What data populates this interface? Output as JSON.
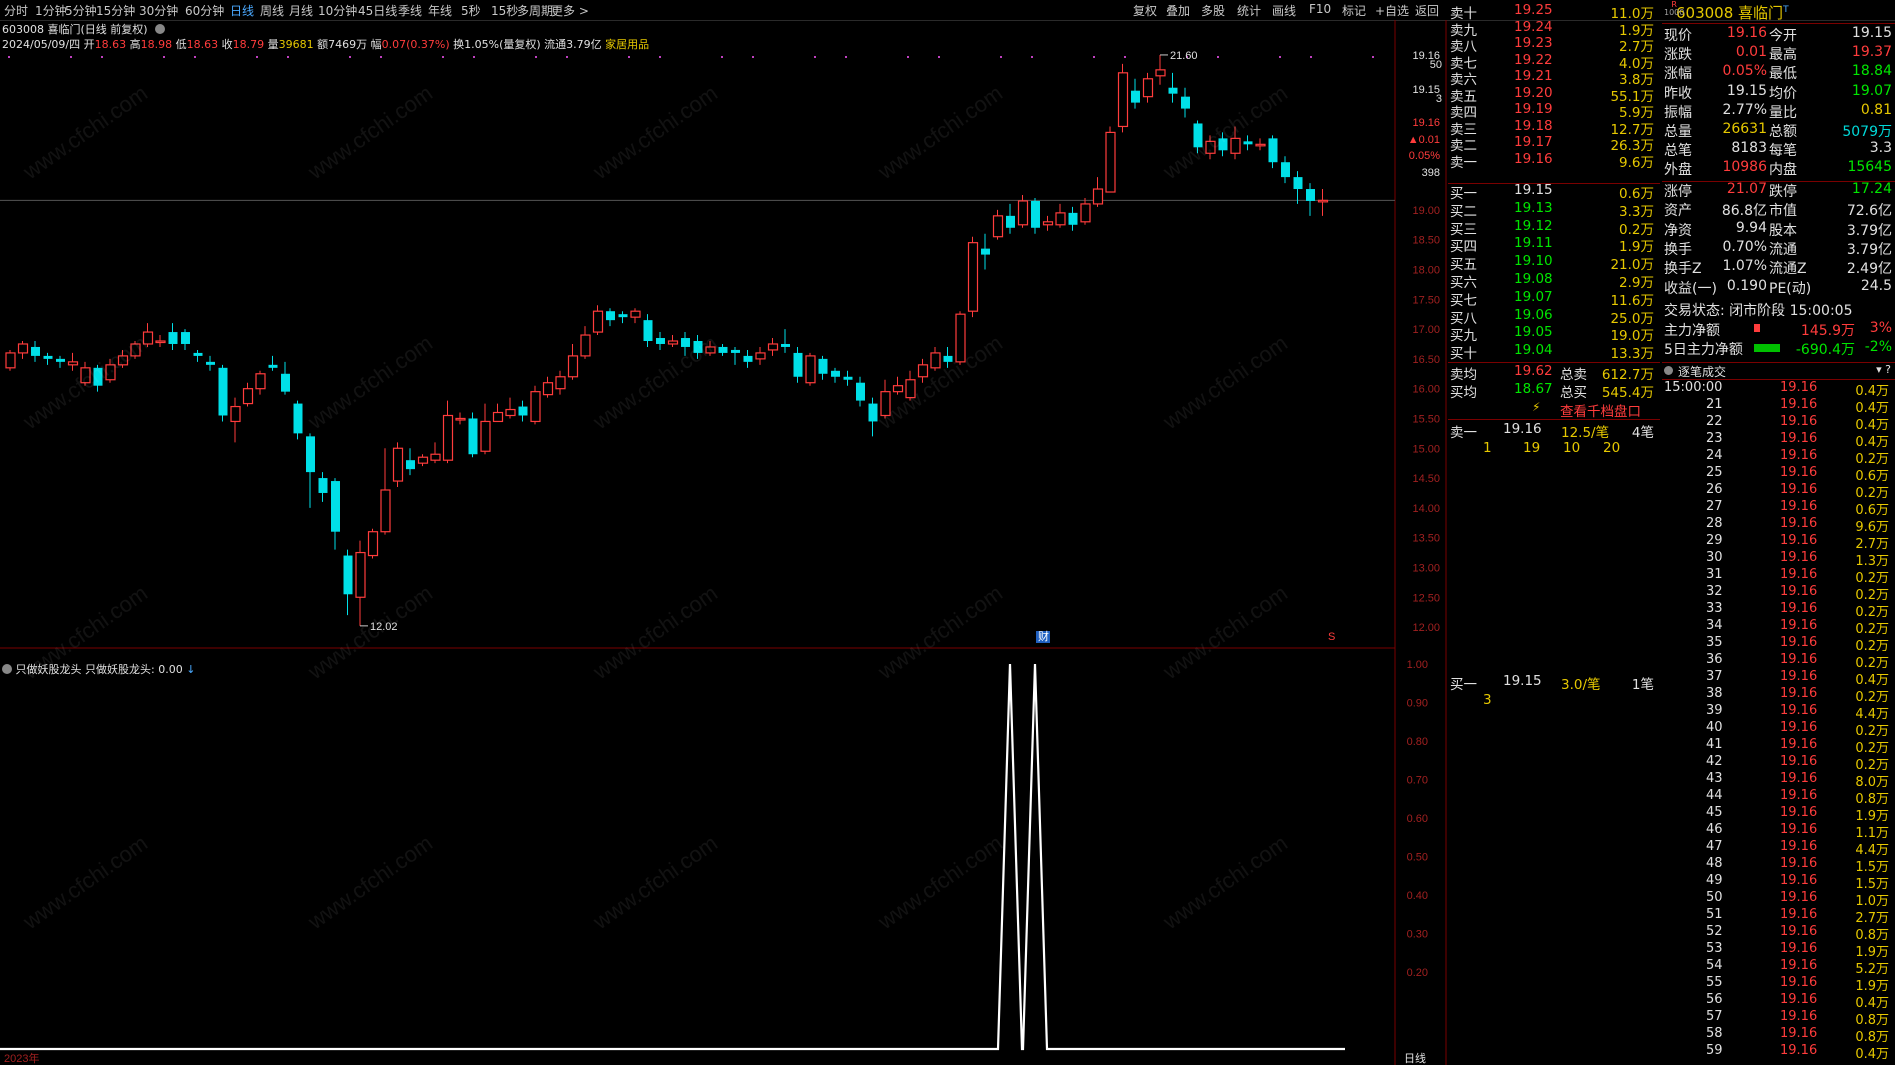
{
  "toolbar": {
    "periods": [
      {
        "label": "分时",
        "active": false
      },
      {
        "label": "1分钟",
        "active": false
      },
      {
        "label": "5分钟",
        "active": false
      },
      {
        "label": "15分钟",
        "active": false
      },
      {
        "label": "30分钟",
        "active": false
      },
      {
        "label": "60分钟",
        "active": false
      },
      {
        "label": "日线",
        "active": true
      },
      {
        "label": "周线",
        "active": false
      },
      {
        "label": "月线",
        "active": false
      },
      {
        "label": "10分钟",
        "active": false
      },
      {
        "label": "45日线",
        "active": false
      },
      {
        "label": "季线",
        "active": false
      },
      {
        "label": "年线",
        "active": false
      },
      {
        "label": "5秒",
        "active": false
      },
      {
        "label": "15秒",
        "active": false
      },
      {
        "label": "多周期",
        "active": false
      },
      {
        "label": "更多 >",
        "active": false
      }
    ],
    "tools": [
      "复权",
      "叠加",
      "多股",
      "统计",
      "画线",
      "F10",
      "标记",
      "+自选",
      "返回"
    ]
  },
  "chart": {
    "title": "603008 喜临门(日线 前复权)",
    "info": {
      "date": "2024/05/09/四",
      "open_label": "开",
      "open": "18.63",
      "high_label": "高",
      "high": "18.98",
      "low_label": "低",
      "low": "18.63",
      "close_label": "收",
      "close": "18.79",
      "vol_label": "量",
      "vol": "39681",
      "amt_label": "额",
      "amt": "7469万",
      "chg_label": "幅",
      "chg": "0.07(0.37%)",
      "turn": "换1.05%(量复权)",
      "float": "流通3.79亿",
      "sector": "家居用品"
    },
    "price_labels": [
      "19.16",
      "19.15",
      "19.00",
      "18.50",
      "18.00",
      "17.50",
      "17.00",
      "16.50",
      "16.00",
      "15.50",
      "15.00",
      "14.50",
      "14.00",
      "13.50",
      "13.00",
      "12.50",
      "12.00"
    ],
    "mini_labels": [
      "50",
      "3",
      "19.16",
      "▲0.01",
      "0.05%",
      "398"
    ],
    "max_label": "21.60",
    "min_label": "12.02",
    "marker_cai": "财",
    "marker_s": "S",
    "indicator_name": "只做妖股龙头",
    "indicator_value": "只做妖股龙头: 0.00",
    "indicator_labels": [
      "1.00",
      "0.90",
      "0.80",
      "0.70",
      "0.60",
      "0.50",
      "0.40",
      "0.30",
      "0.20"
    ],
    "xaxis": {
      "year_label": "2023年",
      "period_label": "日线"
    },
    "colors": {
      "up": "#ff3c3c",
      "down": "#00e0e8",
      "accent": "#4aa9ff"
    }
  },
  "chart_data": {
    "type": "candlestick",
    "title": "603008 喜临门(日线 前复权)",
    "y_range": [
      11.85,
      21.75
    ],
    "candles": [
      [
        16.35,
        16.6,
        16.65,
        16.3
      ],
      [
        16.6,
        16.75,
        16.8,
        16.5
      ],
      [
        16.7,
        16.55,
        16.8,
        16.45
      ],
      [
        16.55,
        16.5,
        16.6,
        16.4
      ],
      [
        16.5,
        16.45,
        16.55,
        16.35
      ],
      [
        16.4,
        16.45,
        16.6,
        16.3
      ],
      [
        16.1,
        16.35,
        16.45,
        16.05
      ],
      [
        16.35,
        16.05,
        16.4,
        15.95
      ],
      [
        16.15,
        16.4,
        16.5,
        16.1
      ],
      [
        16.4,
        16.55,
        16.65,
        16.35
      ],
      [
        16.55,
        16.75,
        16.8,
        16.5
      ],
      [
        16.75,
        16.95,
        17.1,
        16.7
      ],
      [
        16.8,
        16.8,
        16.9,
        16.7
      ],
      [
        16.95,
        16.75,
        17.1,
        16.65
      ],
      [
        16.95,
        16.75,
        17.0,
        16.65
      ],
      [
        16.6,
        16.55,
        16.65,
        16.45
      ],
      [
        16.45,
        16.4,
        16.55,
        16.3
      ],
      [
        16.35,
        15.55,
        16.4,
        15.45
      ],
      [
        15.45,
        15.7,
        15.85,
        15.1
      ],
      [
        15.75,
        16.0,
        16.1,
        15.7
      ],
      [
        16.0,
        16.25,
        16.3,
        15.9
      ],
      [
        16.4,
        16.35,
        16.55,
        16.3
      ],
      [
        16.25,
        15.95,
        16.45,
        15.9
      ],
      [
        15.75,
        15.25,
        15.8,
        15.15
      ],
      [
        15.2,
        14.6,
        15.25,
        14.0
      ],
      [
        14.5,
        14.25,
        14.6,
        14.1
      ],
      [
        14.45,
        13.6,
        14.5,
        13.3
      ],
      [
        13.2,
        12.55,
        13.3,
        12.2
      ],
      [
        12.5,
        13.25,
        13.45,
        12.02
      ],
      [
        13.2,
        13.6,
        13.65,
        13.15
      ],
      [
        13.6,
        14.3,
        15.0,
        13.55
      ],
      [
        14.45,
        15.0,
        15.1,
        14.35
      ],
      [
        14.8,
        14.65,
        15.0,
        14.55
      ],
      [
        14.75,
        14.85,
        14.9,
        14.7
      ],
      [
        14.8,
        14.9,
        15.1,
        14.75
      ],
      [
        14.8,
        15.55,
        15.8,
        14.75
      ],
      [
        15.5,
        15.5,
        15.6,
        15.4
      ],
      [
        15.5,
        14.9,
        15.6,
        14.85
      ],
      [
        14.95,
        15.45,
        15.75,
        14.9
      ],
      [
        15.45,
        15.6,
        15.75,
        15.45
      ],
      [
        15.55,
        15.65,
        15.85,
        15.5
      ],
      [
        15.7,
        15.55,
        15.8,
        15.45
      ],
      [
        15.45,
        15.95,
        16.05,
        15.4
      ],
      [
        15.9,
        16.1,
        16.2,
        15.85
      ],
      [
        16.0,
        16.2,
        16.3,
        15.9
      ],
      [
        16.2,
        16.55,
        16.75,
        16.15
      ],
      [
        16.55,
        16.9,
        17.05,
        16.5
      ],
      [
        16.95,
        17.3,
        17.4,
        16.9
      ],
      [
        17.3,
        17.15,
        17.35,
        17.05
      ],
      [
        17.25,
        17.2,
        17.3,
        17.1
      ],
      [
        17.2,
        17.3,
        17.35,
        17.1
      ],
      [
        17.15,
        16.8,
        17.25,
        16.7
      ],
      [
        16.85,
        16.75,
        16.95,
        16.65
      ],
      [
        16.75,
        16.8,
        16.9,
        16.7
      ],
      [
        16.85,
        16.7,
        16.95,
        16.55
      ],
      [
        16.8,
        16.6,
        16.9,
        16.5
      ],
      [
        16.6,
        16.7,
        16.8,
        16.55
      ],
      [
        16.7,
        16.6,
        16.75,
        16.55
      ],
      [
        16.65,
        16.6,
        16.7,
        16.4
      ],
      [
        16.55,
        16.45,
        16.65,
        16.35
      ],
      [
        16.5,
        16.6,
        16.7,
        16.4
      ],
      [
        16.65,
        16.75,
        16.85,
        16.55
      ],
      [
        16.75,
        16.7,
        17.0,
        16.6
      ],
      [
        16.6,
        16.2,
        16.7,
        16.1
      ],
      [
        16.1,
        16.55,
        16.6,
        16.05
      ],
      [
        16.5,
        16.25,
        16.55,
        16.15
      ],
      [
        16.3,
        16.2,
        16.35,
        16.1
      ],
      [
        16.2,
        16.15,
        16.3,
        16.05
      ],
      [
        16.1,
        15.8,
        16.2,
        15.7
      ],
      [
        15.75,
        15.45,
        15.85,
        15.2
      ],
      [
        15.55,
        15.95,
        16.15,
        15.5
      ],
      [
        15.95,
        16.05,
        16.2,
        15.9
      ],
      [
        15.85,
        16.15,
        16.3,
        15.8
      ],
      [
        16.2,
        16.4,
        16.5,
        16.1
      ],
      [
        16.35,
        16.6,
        16.7,
        16.3
      ],
      [
        16.55,
        16.45,
        16.7,
        16.35
      ],
      [
        16.45,
        17.25,
        17.3,
        16.4
      ],
      [
        17.3,
        18.45,
        18.55,
        17.2
      ],
      [
        18.35,
        18.25,
        18.6,
        18.0
      ],
      [
        18.55,
        18.9,
        19.0,
        18.5
      ],
      [
        18.9,
        18.7,
        19.1,
        18.6
      ],
      [
        18.75,
        19.15,
        19.25,
        18.7
      ],
      [
        19.15,
        18.7,
        19.2,
        18.6
      ],
      [
        18.75,
        18.8,
        18.9,
        18.65
      ],
      [
        18.75,
        18.95,
        19.1,
        18.7
      ],
      [
        18.95,
        18.75,
        19.05,
        18.65
      ],
      [
        18.8,
        19.1,
        19.2,
        18.75
      ],
      [
        19.1,
        19.35,
        19.55,
        19.05
      ],
      [
        19.3,
        20.3,
        20.4,
        19.3
      ],
      [
        20.4,
        21.3,
        21.45,
        20.3
      ],
      [
        21.0,
        20.8,
        21.2,
        20.7
      ],
      [
        20.9,
        21.2,
        21.3,
        20.8
      ],
      [
        21.25,
        21.35,
        21.6,
        21.1
      ],
      [
        21.05,
        20.95,
        21.3,
        20.8
      ],
      [
        20.9,
        20.7,
        21.05,
        20.55
      ],
      [
        20.45,
        20.05,
        20.5,
        19.95
      ],
      [
        19.95,
        20.15,
        20.25,
        19.85
      ],
      [
        20.2,
        20.0,
        20.3,
        19.9
      ],
      [
        19.95,
        20.2,
        20.4,
        19.85
      ],
      [
        20.15,
        20.1,
        20.25,
        20.0
      ],
      [
        20.1,
        20.1,
        20.2,
        20.0
      ],
      [
        20.2,
        19.8,
        20.25,
        19.7
      ],
      [
        19.8,
        19.55,
        19.9,
        19.45
      ],
      [
        19.55,
        19.35,
        19.65,
        19.1
      ],
      [
        19.35,
        19.15,
        19.45,
        18.9
      ],
      [
        19.15,
        19.16,
        19.35,
        18.9
      ]
    ],
    "indicator": {
      "name": "只做妖股龙头",
      "range": [
        0,
        1
      ],
      "spikes_at": [
        80,
        82
      ],
      "value": 0.0
    }
  },
  "orderbook": {
    "sells": [
      {
        "label": "卖十",
        "price": "19.25",
        "vol": "11.0万"
      },
      {
        "label": "卖九",
        "price": "19.24",
        "vol": "1.9万"
      },
      {
        "label": "卖八",
        "price": "19.23",
        "vol": "2.7万"
      },
      {
        "label": "卖七",
        "price": "19.22",
        "vol": "4.0万"
      },
      {
        "label": "卖六",
        "price": "19.21",
        "vol": "3.8万"
      },
      {
        "label": "卖五",
        "price": "19.20",
        "vol": "55.1万"
      },
      {
        "label": "卖四",
        "price": "19.19",
        "vol": "5.9万"
      },
      {
        "label": "卖三",
        "price": "19.18",
        "vol": "12.7万"
      },
      {
        "label": "卖二",
        "price": "19.17",
        "vol": "26.3万"
      },
      {
        "label": "卖一",
        "price": "19.16",
        "vol": "9.6万"
      }
    ],
    "buys": [
      {
        "label": "买一",
        "price": "19.15",
        "vol": "0.6万"
      },
      {
        "label": "买二",
        "price": "19.13",
        "vol": "3.3万"
      },
      {
        "label": "买三",
        "price": "19.12",
        "vol": "0.2万"
      },
      {
        "label": "买四",
        "price": "19.11",
        "vol": "1.9万"
      },
      {
        "label": "买五",
        "price": "19.10",
        "vol": "21.0万"
      },
      {
        "label": "买六",
        "price": "19.08",
        "vol": "2.9万"
      },
      {
        "label": "买七",
        "price": "19.07",
        "vol": "11.6万"
      },
      {
        "label": "买八",
        "price": "19.06",
        "vol": "25.0万"
      },
      {
        "label": "买九",
        "price": "19.05",
        "vol": "19.0万"
      },
      {
        "label": "买十",
        "price": "19.04",
        "vol": "13.3万"
      }
    ],
    "avg_sell": {
      "label": "卖均",
      "price": "19.62",
      "tot_label": "总卖",
      "tot": "612.7万"
    },
    "avg_buy": {
      "label": "买均",
      "price": "18.67",
      "tot_label": "总买",
      "tot": "545.4万"
    },
    "view_link": "查看千档盘口",
    "sell1": {
      "label": "卖一",
      "price": "19.16",
      "per": "12.5/笔",
      "count": "4笔",
      "queue": [
        "1",
        "19",
        "10",
        "20"
      ]
    },
    "buy1": {
      "label": "买一",
      "price": "19.15",
      "per": "3.0/笔",
      "count": "1笔",
      "queue": [
        "3"
      ]
    }
  },
  "quote": {
    "code": "603008",
    "name": "喜临门",
    "badge_r": "R",
    "badge_n": "1000",
    "badge_t": "T",
    "rows": [
      {
        "l1": "现价",
        "v1": "19.16",
        "c1": "red",
        "l2": "今开",
        "v2": "19.15",
        "c2": "wht"
      },
      {
        "l1": "涨跌",
        "v1": "0.01",
        "c1": "red",
        "l2": "最高",
        "v2": "19.37",
        "c2": "red"
      },
      {
        "l1": "涨幅",
        "v1": "0.05%",
        "c1": "red",
        "l2": "最低",
        "v2": "18.84",
        "c2": "green"
      },
      {
        "l1": "昨收",
        "v1": "19.15",
        "c1": "wht",
        "l2": "均价",
        "v2": "19.07",
        "c2": "green"
      },
      {
        "l1": "振幅",
        "v1": "2.77%",
        "c1": "wht",
        "l2": "量比",
        "v2": "0.81",
        "c2": "yel"
      },
      {
        "l1": "总量",
        "v1": "26631",
        "c1": "yel",
        "l2": "总额",
        "v2": "5079万",
        "c2": "cy"
      },
      {
        "l1": "总笔",
        "v1": "8183",
        "c1": "wht",
        "l2": "每笔",
        "v2": "3.3",
        "c2": "wht"
      },
      {
        "l1": "外盘",
        "v1": "10986",
        "c1": "red",
        "l2": "内盘",
        "v2": "15645",
        "c2": "green"
      },
      {
        "l1": "涨停",
        "v1": "21.07",
        "c1": "red",
        "l2": "跌停",
        "v2": "17.24",
        "c2": "green"
      },
      {
        "l1": "资产",
        "v1": "86.8亿",
        "c1": "wht",
        "l2": "市值",
        "v2": "72.6亿",
        "c2": "wht"
      },
      {
        "l1": "净资",
        "v1": "9.94",
        "c1": "wht",
        "l2": "股本",
        "v2": "3.79亿",
        "c2": "wht"
      },
      {
        "l1": "换手",
        "v1": "0.70%",
        "c1": "wht",
        "l2": "流通",
        "v2": "3.79亿",
        "c2": "wht"
      },
      {
        "l1": "换手Z",
        "v1": "1.07%",
        "c1": "wht",
        "l2": "流通Z",
        "v2": "2.49亿",
        "c2": "wht"
      },
      {
        "l1": "收益(一)",
        "v1": "0.190",
        "c1": "wht",
        "l2": "PE(动)",
        "v2": "24.5",
        "c2": "wht"
      }
    ],
    "trade_status": "交易状态: 闭市阶段 15:00:05",
    "main_net": {
      "label": "主力净额",
      "value": "145.9万",
      "pct": "3%"
    },
    "main_net5": {
      "label": "5日主力净额",
      "value": "-690.4万",
      "pct": "-2%"
    }
  },
  "ticks": {
    "title": "逐笔成交",
    "first_time": "15:00:00",
    "rows": [
      [
        "",
        "19.16",
        "0.4万"
      ],
      [
        "21",
        "19.16",
        "0.4万"
      ],
      [
        "22",
        "19.16",
        "0.4万"
      ],
      [
        "23",
        "19.16",
        "0.4万"
      ],
      [
        "24",
        "19.16",
        "0.2万"
      ],
      [
        "25",
        "19.16",
        "0.6万"
      ],
      [
        "26",
        "19.16",
        "0.2万"
      ],
      [
        "27",
        "19.16",
        "0.6万"
      ],
      [
        "28",
        "19.16",
        "9.6万"
      ],
      [
        "29",
        "19.16",
        "2.7万"
      ],
      [
        "30",
        "19.16",
        "1.3万"
      ],
      [
        "31",
        "19.16",
        "0.2万"
      ],
      [
        "32",
        "19.16",
        "0.2万"
      ],
      [
        "33",
        "19.16",
        "0.2万"
      ],
      [
        "34",
        "19.16",
        "0.2万"
      ],
      [
        "35",
        "19.16",
        "0.2万"
      ],
      [
        "36",
        "19.16",
        "0.2万"
      ],
      [
        "37",
        "19.16",
        "0.4万"
      ],
      [
        "38",
        "19.16",
        "0.2万"
      ],
      [
        "39",
        "19.16",
        "4.4万"
      ],
      [
        "40",
        "19.16",
        "0.2万"
      ],
      [
        "41",
        "19.16",
        "0.2万"
      ],
      [
        "42",
        "19.16",
        "0.2万"
      ],
      [
        "43",
        "19.16",
        "8.0万"
      ],
      [
        "44",
        "19.16",
        "0.8万"
      ],
      [
        "45",
        "19.16",
        "1.9万"
      ],
      [
        "46",
        "19.16",
        "1.1万"
      ],
      [
        "47",
        "19.16",
        "4.4万"
      ],
      [
        "48",
        "19.16",
        "1.5万"
      ],
      [
        "49",
        "19.16",
        "1.5万"
      ],
      [
        "50",
        "19.16",
        "1.0万"
      ],
      [
        "51",
        "19.16",
        "2.7万"
      ],
      [
        "52",
        "19.16",
        "0.8万"
      ],
      [
        "53",
        "19.16",
        "1.9万"
      ],
      [
        "54",
        "19.16",
        "5.2万"
      ],
      [
        "55",
        "19.16",
        "1.9万"
      ],
      [
        "56",
        "19.16",
        "0.4万"
      ],
      [
        "57",
        "19.16",
        "0.8万"
      ],
      [
        "58",
        "19.16",
        "0.8万"
      ],
      [
        "59",
        "19.16",
        "0.4万"
      ]
    ]
  },
  "watermark": "www.cfchi.com"
}
